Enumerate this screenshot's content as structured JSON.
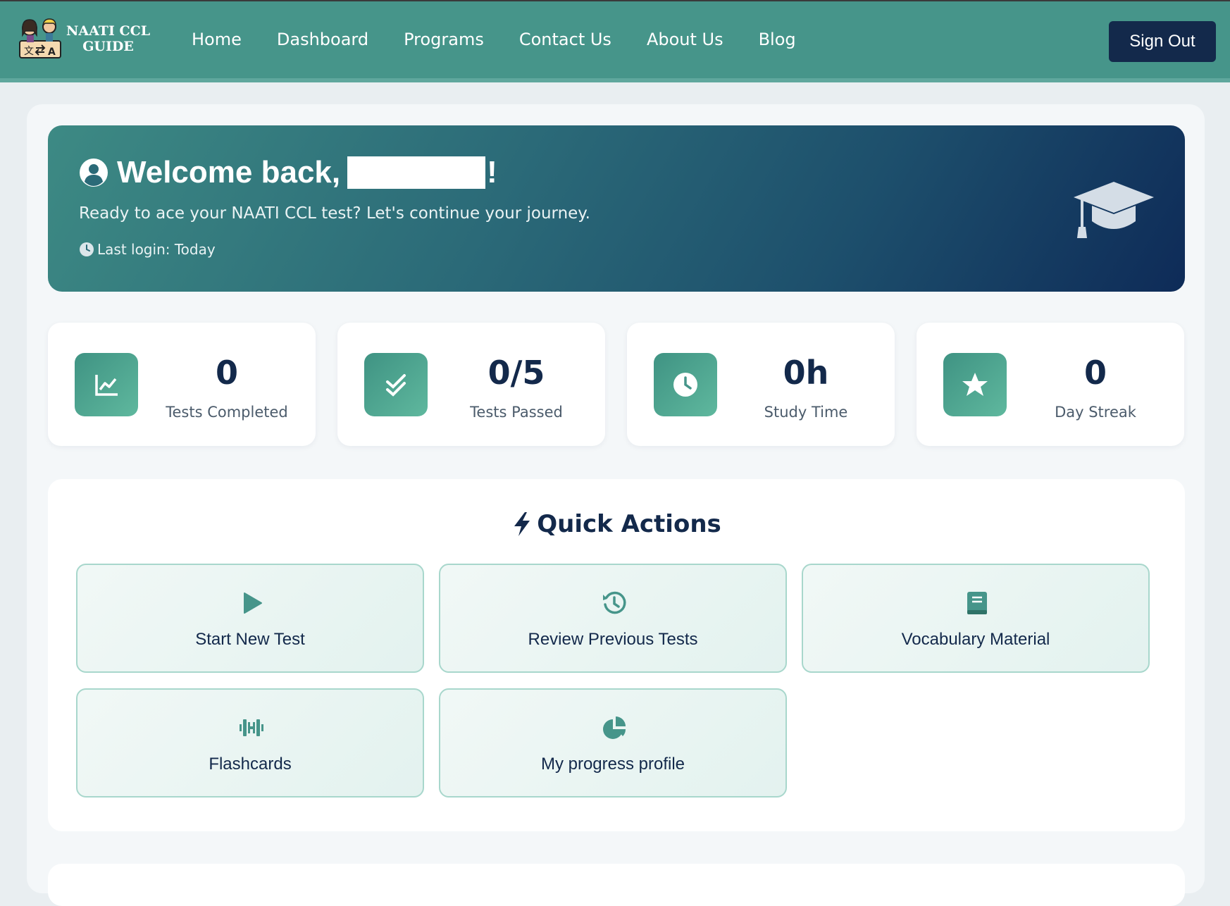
{
  "brand": {
    "name_line1": "NAATI CCL",
    "name_line2": "GUIDE"
  },
  "nav": {
    "items": [
      "Home",
      "Dashboard",
      "Programs",
      "Contact Us",
      "About Us",
      "Blog"
    ],
    "signout_label": "Sign Out"
  },
  "hero": {
    "greeting": "Welcome back,",
    "exclaim": "!",
    "subtitle": "Ready to ace your NAATI CCL test? Let's continue your journey.",
    "last_login": "Last login: Today"
  },
  "stats": [
    {
      "value": "0",
      "label": "Tests Completed",
      "icon": "chart-line-icon"
    },
    {
      "value": "0/5",
      "label": "Tests Passed",
      "icon": "double-check-icon"
    },
    {
      "value": "0h",
      "label": "Study Time",
      "icon": "clock-icon"
    },
    {
      "value": "0",
      "label": "Day Streak",
      "icon": "star-icon"
    }
  ],
  "quick_actions": {
    "title": "Quick Actions",
    "items": [
      {
        "label": "Start New Test",
        "icon": "play-icon"
      },
      {
        "label": "Review Previous Tests",
        "icon": "history-icon"
      },
      {
        "label": "Vocabulary Material",
        "icon": "book-icon"
      },
      {
        "label": "Flashcards",
        "icon": "dumbbell-icon"
      },
      {
        "label": "My progress profile",
        "icon": "pie-chart-icon"
      }
    ]
  },
  "colors": {
    "nav_bg": "#46958a",
    "navy": "#13294b",
    "accent": "#46958a"
  }
}
